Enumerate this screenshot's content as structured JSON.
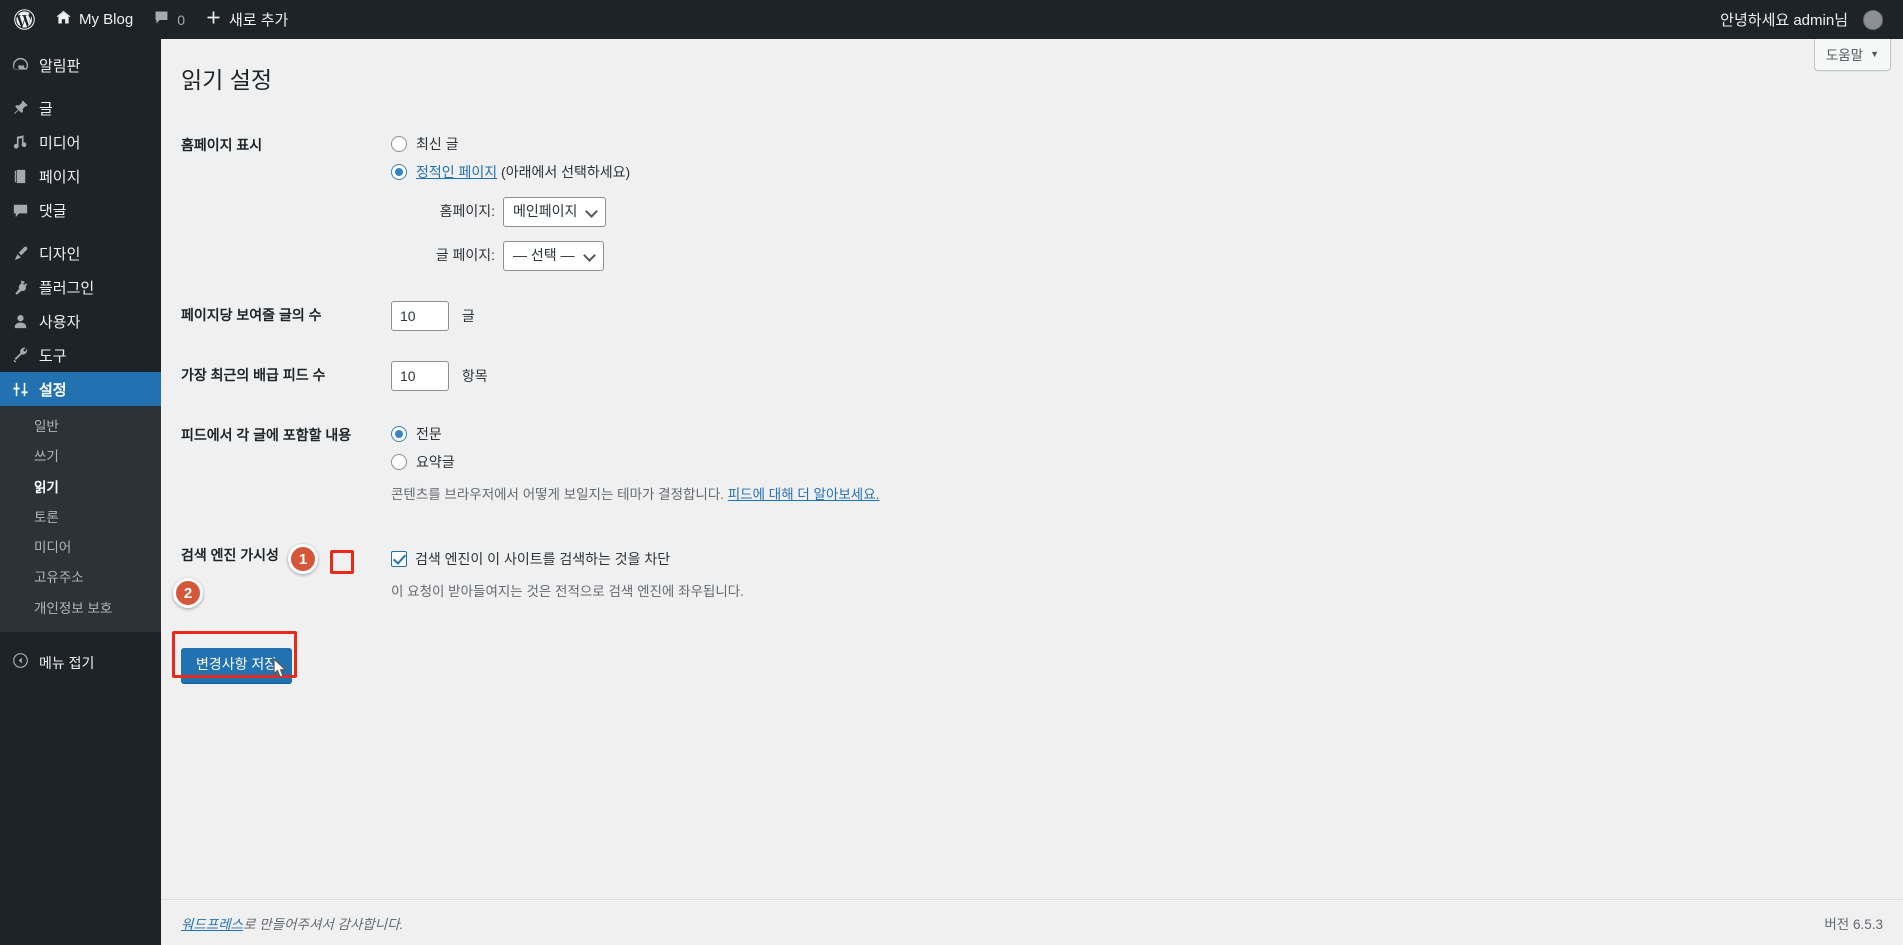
{
  "adminbar": {
    "logo_icon": "wordpress-logo-icon",
    "site_name": "My Blog",
    "home_icon": "home-icon",
    "comments_icon": "comment-bubble-icon",
    "comment_count": "0",
    "new_icon": "plus-icon",
    "new_label": "새로 추가",
    "howdy": "안녕하세요 admin님",
    "avatar": "user-avatar"
  },
  "sidebar": {
    "items": [
      {
        "label": "알림판",
        "icon": "dashboard-icon",
        "current": false
      },
      {
        "label": "글",
        "icon": "pin-icon",
        "current": false
      },
      {
        "label": "미디어",
        "icon": "media-icon",
        "current": false
      },
      {
        "label": "페이지",
        "icon": "page-icon",
        "current": false
      },
      {
        "label": "댓글",
        "icon": "comment-icon",
        "current": false
      },
      {
        "label": "디자인",
        "icon": "appearance-brush-icon",
        "current": false
      },
      {
        "label": "플러그인",
        "icon": "plugin-plug-icon",
        "current": false
      },
      {
        "label": "사용자",
        "icon": "user-icon",
        "current": false
      },
      {
        "label": "도구",
        "icon": "wrench-icon",
        "current": false
      },
      {
        "label": "설정",
        "icon": "settings-sliders-icon",
        "current": true
      }
    ],
    "submenu": [
      {
        "label": "일반",
        "current": false
      },
      {
        "label": "쓰기",
        "current": false
      },
      {
        "label": "읽기",
        "current": true
      },
      {
        "label": "토론",
        "current": false
      },
      {
        "label": "미디어",
        "current": false
      },
      {
        "label": "고유주소",
        "current": false
      },
      {
        "label": "개인정보 보호",
        "current": false
      }
    ],
    "collapse_label": "메뉴 접기",
    "collapse_icon": "collapse-arrow-icon"
  },
  "page": {
    "title": "읽기 설정",
    "help_label": "도움말",
    "help_caret_icon": "caret-down-icon"
  },
  "settings": {
    "homepage_display": {
      "label": "홈페이지 표시",
      "options": [
        {
          "label": "최신 글",
          "checked": false
        },
        {
          "label": "정적인 페이지",
          "suffix": " (아래에서 선택하세요)",
          "checked": true
        }
      ],
      "homepage_select": {
        "label": "홈페이지:",
        "value": "메인페이지"
      },
      "posts_page_select": {
        "label": "글 페이지:",
        "value": "— 선택 —"
      }
    },
    "posts_per_page": {
      "label": "페이지당 보여줄 글의 수",
      "value": "10",
      "unit": "글"
    },
    "feed_items": {
      "label": "가장 최근의 배급 피드 수",
      "value": "10",
      "unit": "항목"
    },
    "feed_content": {
      "label": "피드에서 각 글에 포함할 내용",
      "options": [
        {
          "label": "전문",
          "checked": true
        },
        {
          "label": "요약글",
          "checked": false
        }
      ],
      "description_prefix": "콘텐츠를 브라우저에서 어떻게 보일지는 테마가 결정합니다. ",
      "description_link": "피드에 대해 더 알아보세요.",
      "description_suffix": ""
    },
    "search_visibility": {
      "label": "검색 엔진 가시성",
      "checkbox_label": "검색 엔진이 이 사이트를 검색하는 것을 차단",
      "checked": true,
      "description": "이 요청이 받아들여지는 것은 전적으로 검색 엔진에 좌우됩니다."
    },
    "submit_label": "변경사항 저장"
  },
  "annotations": {
    "badge_1": "1",
    "badge_2": "2",
    "badge_color": "#d4573a",
    "highlight_color": "#e8291c"
  },
  "footer": {
    "link_text": "워드프레스",
    "thanks_text": "로 만들어주셔서 감사합니다.",
    "version": "버전 6.5.3"
  }
}
